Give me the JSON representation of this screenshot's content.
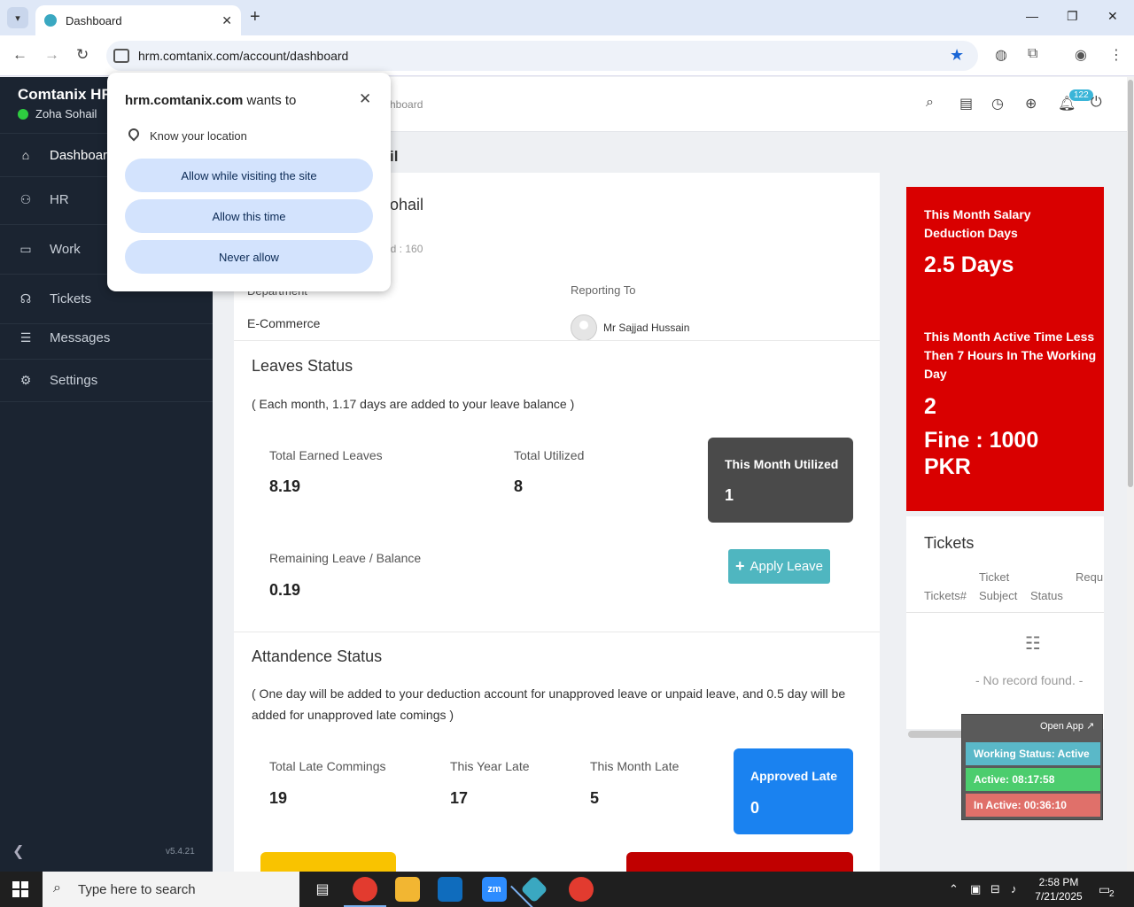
{
  "browser": {
    "tab_title": "Dashboard",
    "url": "hrm.comtanix.com/account/dashboard"
  },
  "popup": {
    "site": "hrm.comtanix.com",
    "wants": " wants to",
    "permission": "Know your location",
    "btn_allow_visiting": "Allow while visiting the site",
    "btn_allow_once": "Allow this time",
    "btn_never": "Never allow"
  },
  "sidebar": {
    "brand": "Comtanix HR",
    "user": "Zoha Sohail",
    "items": [
      {
        "label": "Dashboard"
      },
      {
        "label": "HR"
      },
      {
        "label": "Work"
      },
      {
        "label": "Tickets"
      },
      {
        "label": "Messages"
      },
      {
        "label": "Settings"
      }
    ],
    "version": "v5.4.21"
  },
  "header": {
    "breadcrumb": "hboard",
    "notifications_count": "122"
  },
  "welcome_fragment": "il",
  "profile": {
    "name_fragment": "ohail",
    "emp_id_fragment": "ld : 160",
    "department_label": "Department",
    "department_value": "E-Commerce",
    "reporting_label": "Reporting To",
    "reporting_value": "Mr Sajjad Hussain"
  },
  "leaves": {
    "title": "Leaves Status",
    "note": "( Each month, 1.17 days are added to your leave balance )",
    "earned_label": "Total Earned Leaves",
    "earned_value": "8.19",
    "utilized_label": "Total Utilized",
    "utilized_value": "8",
    "month_utilized_label": "This Month Utilized",
    "month_utilized_value": "1",
    "remaining_label": "Remaining Leave / Balance",
    "remaining_value": "0.19",
    "apply_button": "Apply Leave"
  },
  "attendance": {
    "title": "Attandence Status",
    "note": "( One day will be added to your deduction account for unapproved leave or unpaid leave, and 0.5 day will be added for unapproved late comings )",
    "late_total_label": "Total Late Commings",
    "late_total_value": "19",
    "year_late_label": "This Year Late",
    "year_late_value": "17",
    "month_late_label": "This Month Late",
    "month_late_value": "5",
    "approved_late_label": "Approved Late",
    "approved_late_value": "0"
  },
  "deduction": {
    "title1": "This Month Salary Deduction Days",
    "value1": "2.5 Days",
    "title2": "This Month Active Time Less Then 7 Hours In The Working Day",
    "value2": "2",
    "fine": "Fine : 1000 PKR"
  },
  "tickets": {
    "title": "Tickets",
    "col_ticket_no": "Tickets#",
    "col_subject": "Ticket Subject",
    "col_status": "Status",
    "col_requester": "Requ",
    "empty": "- No record found. -"
  },
  "status_widget": {
    "open_app": "Open App ↗",
    "working_status": "Working Status: Active",
    "active": "Active: 08:17:58",
    "inactive": "In Active: 00:36:10"
  },
  "taskbar": {
    "search_placeholder": "Type here to search",
    "time": "2:58 PM",
    "date": "7/21/2025",
    "notification_count": "2",
    "zoom_label": "zm"
  },
  "colors": {
    "sidebar": "#1b2431",
    "deduction_red": "#d90000",
    "apply_teal": "#4fb6c0",
    "approved_blue": "#1a82f0",
    "dark_box": "#4a4a4a"
  }
}
